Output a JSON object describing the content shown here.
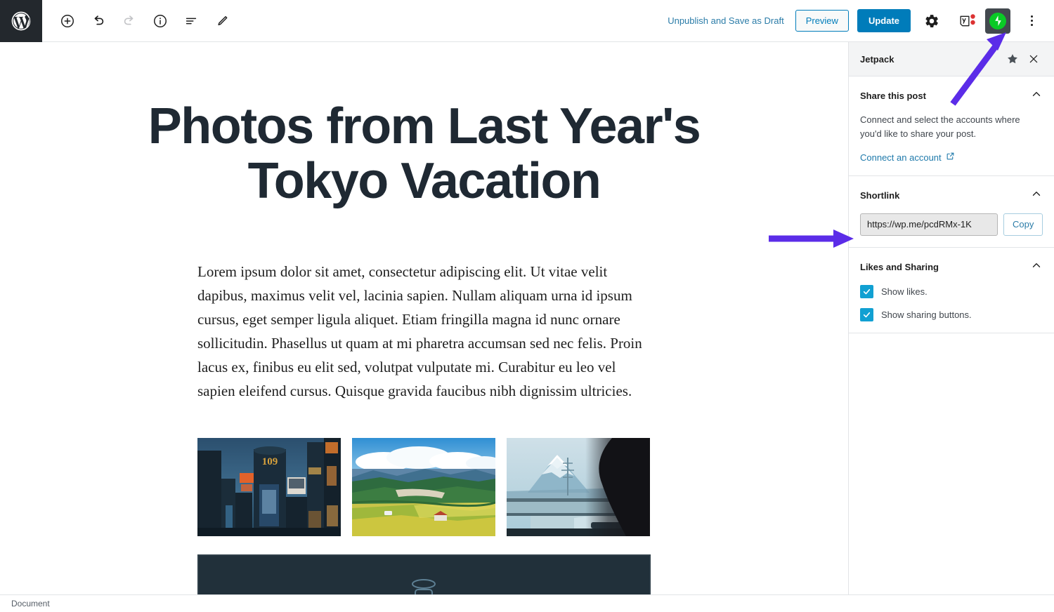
{
  "toolbar": {
    "logo_icon": "wordpress-logo-icon",
    "left_tools": [
      {
        "name": "add-block-button",
        "icon": "plus-circle-icon",
        "label": "Add block",
        "disabled": false
      },
      {
        "name": "undo-button",
        "icon": "undo-icon",
        "label": "Undo",
        "disabled": false
      },
      {
        "name": "redo-button",
        "icon": "redo-icon",
        "label": "Redo",
        "disabled": true
      },
      {
        "name": "details-button",
        "icon": "info-circle-icon",
        "label": "Details",
        "disabled": false
      },
      {
        "name": "block-navigation-button",
        "icon": "list-view-icon",
        "label": "Block navigation",
        "disabled": false
      },
      {
        "name": "edit-mode-button",
        "icon": "pencil-icon",
        "label": "Edit",
        "disabled": false
      }
    ],
    "unpublish_label": "Unpublish and Save as Draft",
    "preview_label": "Preview",
    "update_label": "Update",
    "settings_icon": "gear-icon",
    "yoast_icon": "yoast-seo-icon",
    "jetpack_icon": "jetpack-icon",
    "more_menu_icon": "kebab-menu-icon",
    "accent_blue": "#007cba",
    "link_blue": "#2b7ca8",
    "jetpack_green": "#0aca26"
  },
  "editor": {
    "title": "Photos from Last Year's Tokyo Vacation",
    "paragraph": "Lorem ipsum dolor sit amet, consectetur adipiscing elit. Ut vitae velit dapibus, maximus velit vel, lacinia sapien. Nullam aliquam urna id ipsum cursus, eget semper ligula aliquet. Etiam fringilla magna id nunc ornare sollicitudin. Phasellus ut quam at mi pharetra accumsan sed nec felis. Proin lacus ex, finibus eu elit sed, volutpat vulputate mi. Curabitur eu leo vel sapien eleifend cursus. Quisque gravida faucibus nibh dignissim ultricies.",
    "gallery": [
      {
        "name": "gallery-image-shibuya-night",
        "alt": "Shibuya 109 building at night with neon signs"
      },
      {
        "name": "gallery-image-countryside",
        "alt": "Green countryside fields with mountains and clouds"
      },
      {
        "name": "gallery-image-mount-fuji",
        "alt": "Mount Fuji seen from a train window"
      }
    ],
    "wide_block": {
      "name": "wide-image-block",
      "alt": "Dark train interior image"
    }
  },
  "sidebar": {
    "panel_title": "Jetpack",
    "pin_icon": "star-icon",
    "close_icon": "close-icon",
    "sections": [
      {
        "id": "share-this-post",
        "title": "Share this post",
        "collapse_icon": "chevron-up-icon",
        "description": "Connect and select the accounts where you'd like to share your post.",
        "link_label": "Connect an account",
        "link_icon": "external-link-icon"
      },
      {
        "id": "shortlink",
        "title": "Shortlink",
        "collapse_icon": "chevron-up-icon",
        "url_value": "https://wp.me/pcdRMx-1K",
        "copy_label": "Copy"
      },
      {
        "id": "likes-and-sharing",
        "title": "Likes and Sharing",
        "collapse_icon": "chevron-up-icon",
        "checkboxes": [
          {
            "label": "Show likes.",
            "checked": true
          },
          {
            "label": "Show sharing buttons.",
            "checked": true
          }
        ]
      }
    ],
    "checkbox_color": "#11a0d2"
  },
  "statusbar": {
    "label": "Document"
  },
  "annotations": {
    "arrow_color": "#5b2ce8",
    "arrows": [
      {
        "name": "annotation-arrow-jetpack-icon",
        "points_to": "jetpack-icon"
      },
      {
        "name": "annotation-arrow-shortlink-field",
        "points_to": "shortlink-input"
      }
    ]
  }
}
